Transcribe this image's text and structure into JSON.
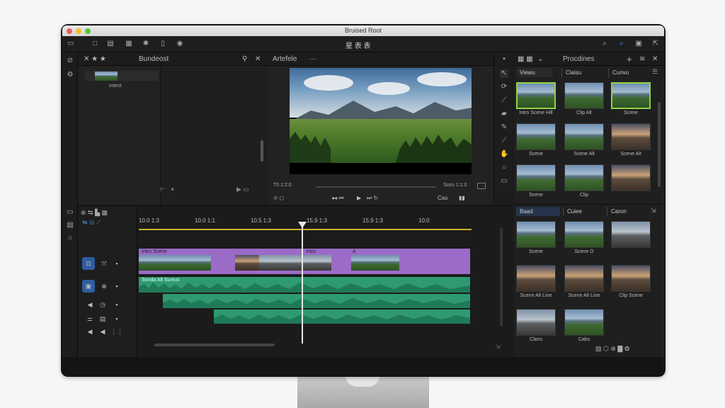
{
  "window": {
    "title": "Bruised Root"
  },
  "toolbar": {
    "center_label": "星 表 表"
  },
  "browser": {
    "tab_title": "Bundeost",
    "tree_item": "Intent"
  },
  "viewer": {
    "tab_title": "Artefele",
    "timecode_left": "T0 1:2:0",
    "timecode_right": "Sozu 1:1:0",
    "zoom_label": "Cas"
  },
  "preview": {
    "tab_title": "Procdines",
    "view_tab": "Viewu",
    "tab_2": "Claisu",
    "tab_3": "Cunvu"
  },
  "ruler": {
    "ticks": [
      "10.0 1:3",
      "10.0 1:1",
      "10.5 1:3",
      "15.9 1:3",
      "15.9 1:3",
      "10:0"
    ]
  },
  "tracks": {
    "video_clip_1": "Intro Scene",
    "video_clip_2": "Intro",
    "video_clip_3": "A",
    "audio_label": "Sonda Alt Sumus"
  },
  "grid_top": {
    "items": [
      {
        "label": "Intro Scene Hill",
        "style": "land",
        "selected": true
      },
      {
        "label": "Clip Alt",
        "style": "land",
        "selected": false
      },
      {
        "label": "Scene",
        "style": "land",
        "selected": true
      },
      {
        "label": "Scene",
        "style": "land",
        "selected": false
      },
      {
        "label": "Scene Alt",
        "style": "land",
        "selected": false
      },
      {
        "label": "Scene Alt",
        "style": "dusk",
        "selected": false
      },
      {
        "label": "Scene",
        "style": "land",
        "selected": false
      },
      {
        "label": "Clip",
        "style": "land",
        "selected": false
      },
      {
        "label": "",
        "style": "dusk",
        "selected": false
      }
    ]
  },
  "grid_bottom_tabs": [
    "Baad",
    "Cuiee",
    "Caron"
  ],
  "grid_bottom": {
    "items": [
      {
        "label": "Scene",
        "style": "land"
      },
      {
        "label": "Scene O",
        "style": "land"
      },
      {
        "label": "",
        "style": "road"
      },
      {
        "label": "Scene Alt Line",
        "style": "dusk"
      },
      {
        "label": "Scene Alt Line",
        "style": "dusk"
      },
      {
        "label": "Clip Scene",
        "style": "dusk"
      },
      {
        "label": "Clans",
        "style": "road"
      },
      {
        "label": "Cabs",
        "style": "land"
      }
    ]
  },
  "colors": {
    "accent": "#2f6cc0",
    "clip": "#9b6bc8",
    "audio": "#2f9a72",
    "select": "#8fd24a"
  }
}
